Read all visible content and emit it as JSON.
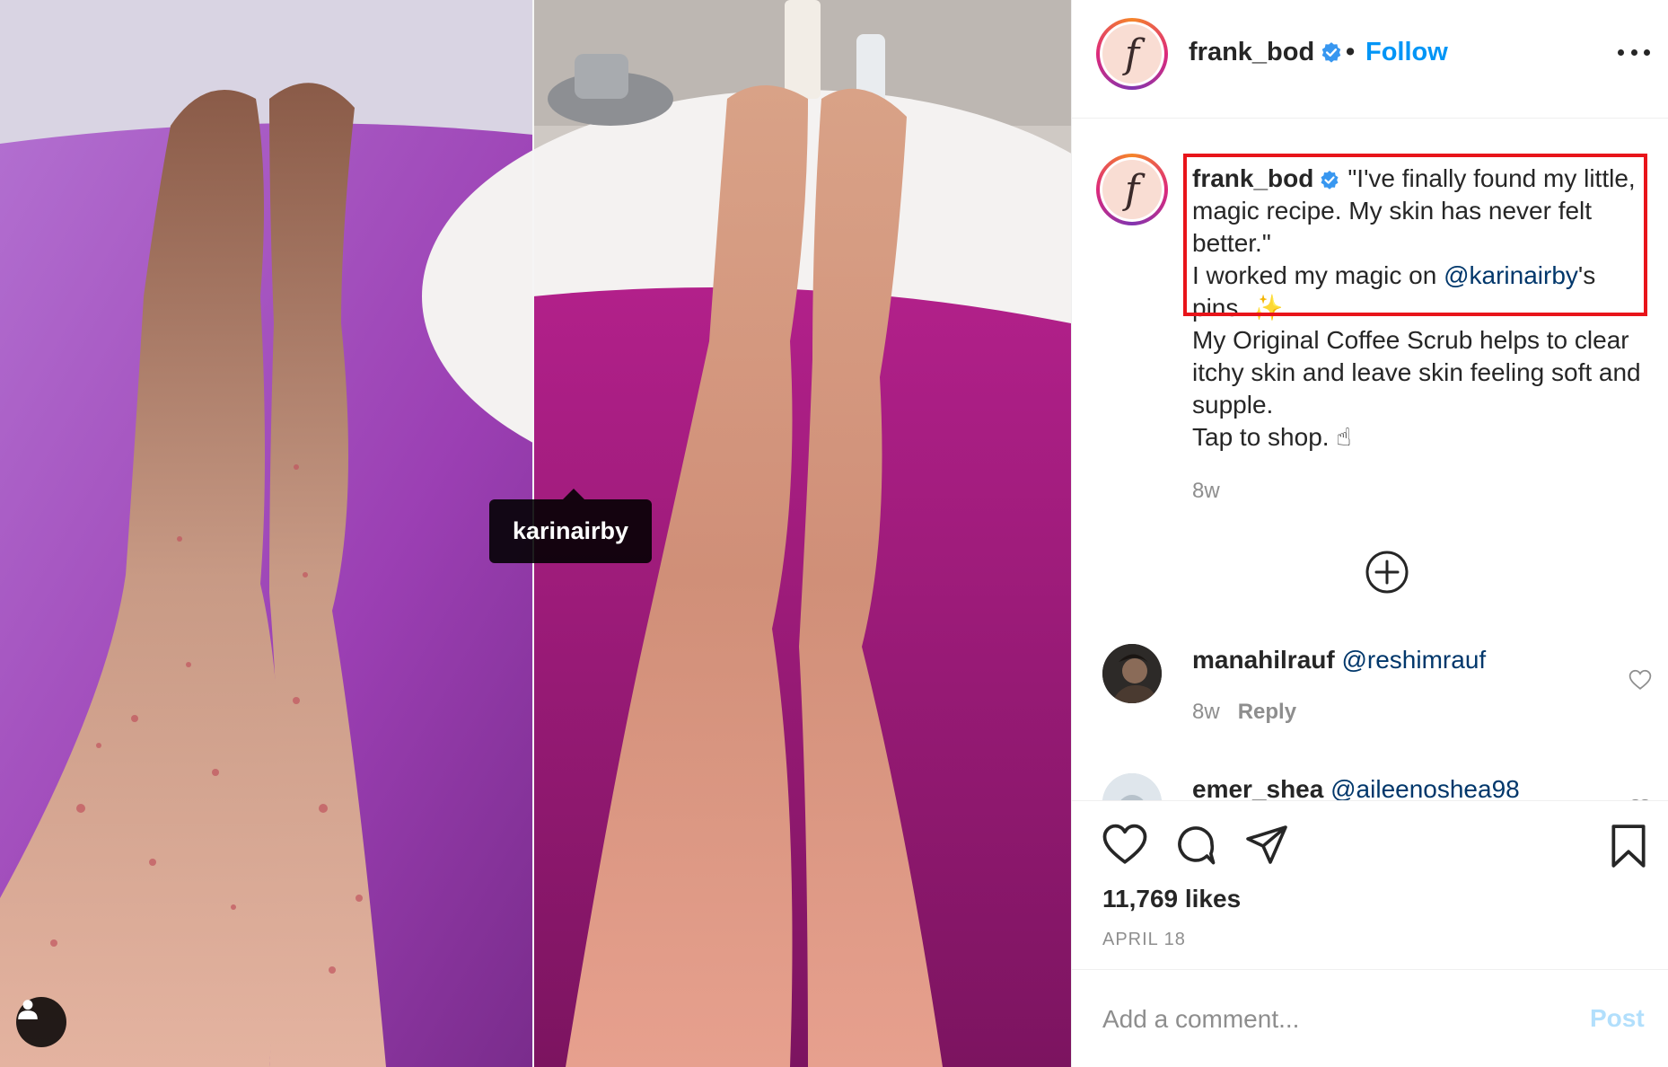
{
  "photo": {
    "tag_label": "karinairby"
  },
  "header": {
    "username": "frank_bod",
    "separator": "•",
    "follow_label": "Follow",
    "avatar_letter": "f"
  },
  "caption": {
    "username": "frank_bod",
    "line_quote": "\"I've finally found my little, magic recipe. My skin has never felt better.\"",
    "line_worked_prefix": "I worked my magic on ",
    "mention": "@karinairby",
    "line_worked_suffix": "'s pins. ✨",
    "line_product": "My Original Coffee Scrub helps to clear itchy skin and leave skin feeling soft and supple.",
    "line_shop": "Tap to shop. ☝",
    "time": "8w"
  },
  "comments": [
    {
      "username": "manahilrauf",
      "mention": "@reshimrauf",
      "time": "8w",
      "reply_label": "Reply"
    },
    {
      "username": "emer_shea",
      "mention": "@aileenoshea98"
    }
  ],
  "actions": {
    "likes": "11,769 likes",
    "date": "APRIL 18"
  },
  "add_comment": {
    "placeholder": "Add a comment...",
    "post_label": "Post"
  },
  "colors": {
    "link_blue": "#0095f6",
    "mention_blue": "#00376b",
    "highlight_red": "#e8141a"
  }
}
